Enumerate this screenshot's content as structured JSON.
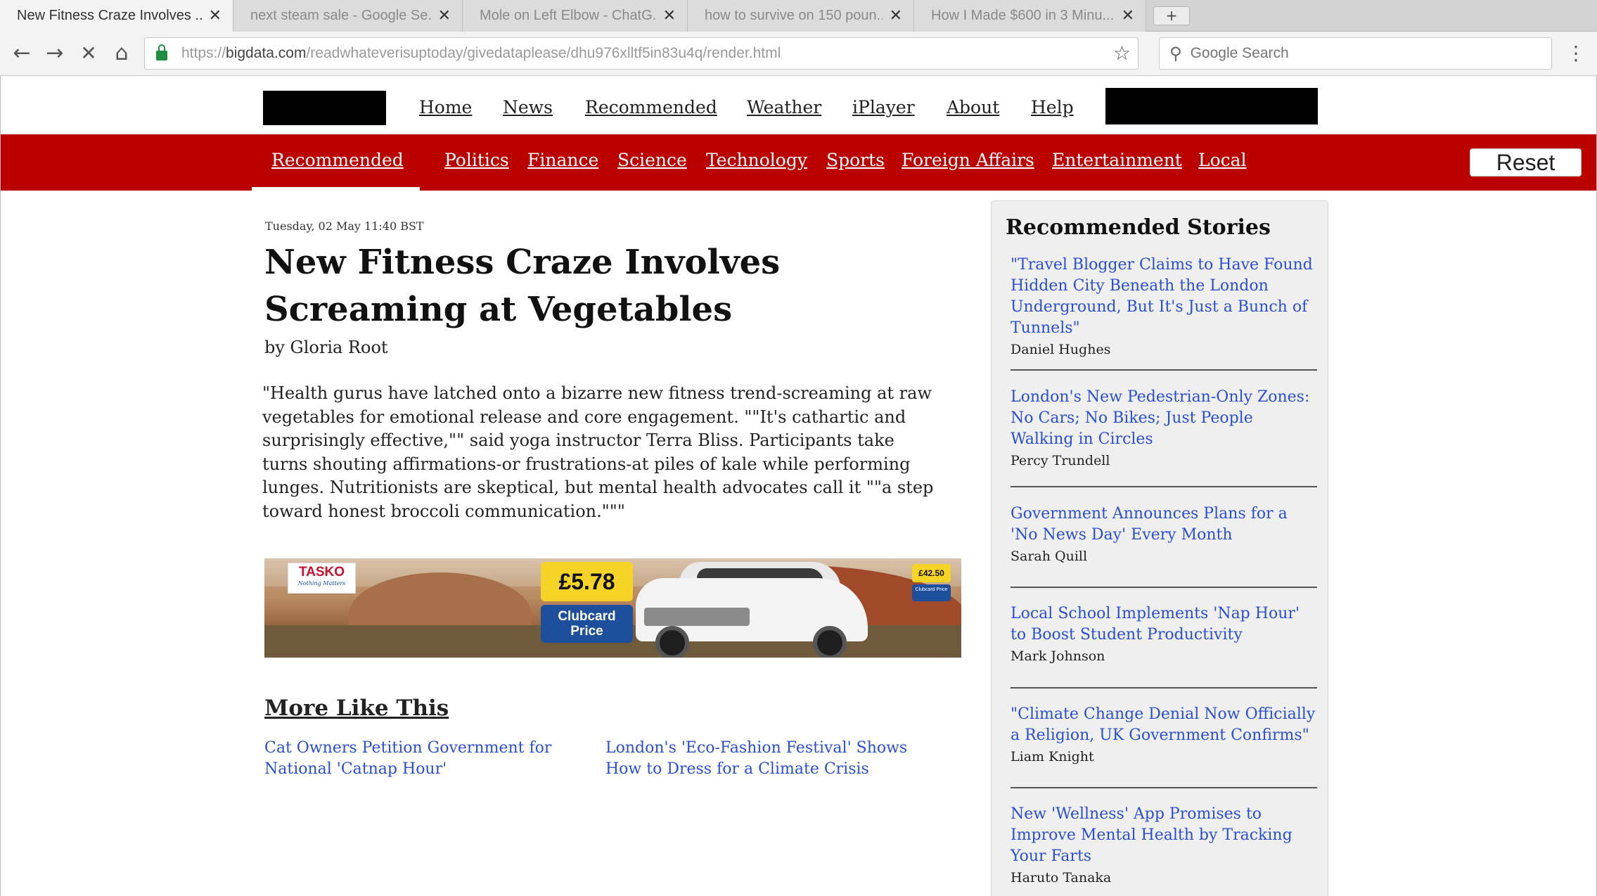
{
  "browser": {
    "tabs": [
      {
        "title": "New Fitness Craze Involves ...",
        "active": true
      },
      {
        "title": "next steam sale - Google Se...",
        "active": false
      },
      {
        "title": "Mole on Left Elbow - ChatG...",
        "active": false
      },
      {
        "title": "how to survive on 150 poun...",
        "active": false
      },
      {
        "title": "How I Made $600 in 3 Minu...",
        "active": false
      }
    ],
    "tab_close_glyph": "✕",
    "new_tab_label": "+",
    "url_prefix": "https://",
    "url_host": "bigdata.com",
    "url_path": "/readwhateverisuptoday/givedataplease/dhu976xlltf5in83u4q/render.html",
    "search_placeholder": "Google Search"
  },
  "site": {
    "main_nav": [
      "Home",
      "News",
      "Recommended",
      "Weather",
      "iPlayer",
      "About",
      "Help"
    ],
    "categories": [
      "Recommended",
      "Politics",
      "Finance",
      "Science",
      "Technology",
      "Sports",
      "Foreign Affairs",
      "Entertainment",
      "Local"
    ],
    "active_category": "Recommended",
    "reset_label": "Reset",
    "colors": {
      "brand_red": "#bb0000",
      "link_blue": "#2a4fd6"
    }
  },
  "article": {
    "dateline": "Tuesday, 02 May 11:40 BST",
    "headline": "New Fitness Craze Involves Screaming at Vegetables",
    "byline": "by Gloria Root",
    "body": "\"Health gurus have latched onto a bizarre new fitness trend-screaming at raw vegetables for emotional release and core engagement. \"\"It's cathartic and surprisingly effective,\"\" said yoga instructor Terra Bliss. Participants take turns shouting affirmations-or frustrations-at piles of kale while performing lunges. Nutritionists are skeptical, but mental health advocates call it \"\"a step toward honest broccoli communication.\"\"\""
  },
  "ad": {
    "brand": "TASKO",
    "tagline": "Nothing Matters",
    "price_main": "£5.78",
    "price_main_caption": "Clubcard Price",
    "price_small": "£42.50",
    "price_small_caption": "Clubcard Price"
  },
  "more_like_this": {
    "heading": "More Like This",
    "items": [
      "Cat Owners Petition Government for National 'Catnap Hour'",
      "London's 'Eco-Fashion Festival' Shows How to Dress for a Climate Crisis"
    ]
  },
  "sidebar": {
    "heading": "Recommended Stories",
    "stories": [
      {
        "title": "\"Travel Blogger Claims to Have Found Hidden City Beneath the London Underground, But It's Just a Bunch of Tunnels\"",
        "author": "Daniel Hughes"
      },
      {
        "title": "London's New Pedestrian-Only Zones: No Cars;  No Bikes;  Just People Walking in Circles",
        "author": "Percy Trundell"
      },
      {
        "title": "Government Announces Plans for a 'No News Day' Every Month",
        "author": "Sarah Quill"
      },
      {
        "title": "Local School Implements 'Nap Hour' to Boost Student Productivity",
        "author": "Mark Johnson"
      },
      {
        "title": "\"Climate Change Denial Now Officially a Religion, UK Government Confirms\"",
        "author": "Liam Knight"
      },
      {
        "title": "New 'Wellness' App Promises to Improve Mental Health by Tracking Your Farts",
        "author": "Haruto Tanaka"
      }
    ]
  }
}
